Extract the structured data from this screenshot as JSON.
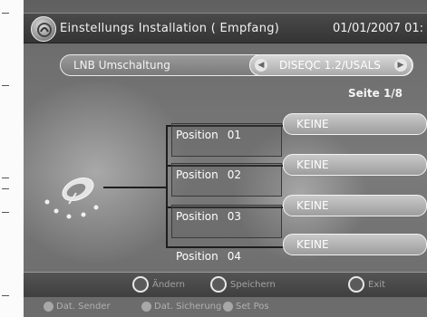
{
  "header": {
    "title": "Einstellungs Installation ( Empfang)",
    "datetime": "01/01/2007 01:"
  },
  "option": {
    "label": "LNB Umschaltung",
    "value": "DISEQC 1.2/USALS"
  },
  "page_indicator": "Seite 1/8",
  "positions": [
    {
      "label": "Position",
      "number": "01",
      "value": "KEINE"
    },
    {
      "label": "Position",
      "number": "02",
      "value": "KEINE"
    },
    {
      "label": "Position",
      "number": "03",
      "value": "KEINE"
    },
    {
      "label": "Position",
      "number": "04",
      "value": "KEINE"
    }
  ],
  "footer": {
    "hints": [
      "Ändern",
      "Speichern",
      "Exit"
    ],
    "hints2": [
      "Dat. Sender",
      "Dat. Sicherung",
      "Set Pos"
    ],
    "colors": {
      "red": "#c94a4a",
      "green": "#5fa45f",
      "yellow": "#d7c447",
      "blue": "#4f74c9"
    }
  }
}
